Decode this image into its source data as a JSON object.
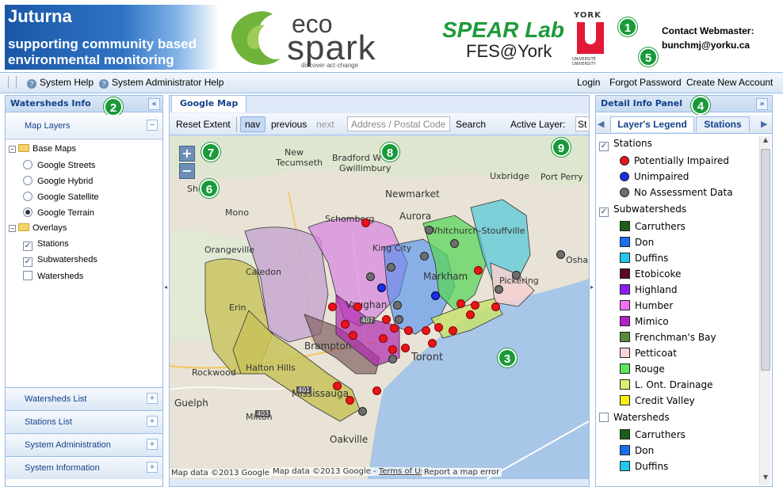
{
  "header": {
    "juturna_title": "Juturna",
    "juturna_line1": "supporting community based",
    "juturna_line2": "environmental monitoring",
    "eco_word": "eco",
    "spark_word": "spark",
    "spark_tagline": "discover·act·change",
    "spear_word": "SPEAR Lab",
    "fes_word": "FES@York",
    "york_word": "YORK",
    "york_univ": "UNIVERSITÉ UNIVERSITY",
    "contact_label": "Contact Webmaster:",
    "contact_email": "bunchmj@yorku.ca"
  },
  "menubar": {
    "system_help": "System Help",
    "admin_help": "System Administrator Help",
    "login": "Login",
    "forgot": "Forgot Password",
    "create": "Create New Account"
  },
  "left_panel": {
    "title": "Watersheds Info",
    "map_layers": "Map Layers",
    "base_maps": "Base Maps",
    "base_items": [
      {
        "label": "Google Streets",
        "selected": false
      },
      {
        "label": "Google Hybrid",
        "selected": false
      },
      {
        "label": "Google Satellite",
        "selected": false
      },
      {
        "label": "Google Terrain",
        "selected": true
      }
    ],
    "overlays": "Overlays",
    "overlay_items": [
      {
        "label": "Stations",
        "checked": true
      },
      {
        "label": "Subwatersheds",
        "checked": true
      },
      {
        "label": "Watersheds",
        "checked": false
      }
    ],
    "sections": [
      "Watersheds List",
      "Stations List",
      "System Administration",
      "System Information"
    ]
  },
  "center": {
    "tab": "Google Map",
    "reset": "Reset Extent",
    "nav": "nav",
    "previous": "previous",
    "next": "next",
    "address_placeholder": "Address / Postal Code",
    "search": "Search",
    "active_layer_label": "Active Layer:",
    "active_layer_value": "St",
    "zoom_in": "+",
    "zoom_out": "−",
    "map_labels": [
      "New",
      "Tecumseth",
      "Bradford W",
      "Gwillimbury",
      "Uxbridge",
      "Port Perry",
      "Shelb",
      "Newmarket",
      "Mono",
      "Schomberg",
      "Aurora",
      "Whitchurch-Stouffville",
      "Orangeville",
      "King City",
      "Caledon",
      "Osha",
      "Markham",
      "Pickering",
      "Erin",
      "Vaughan",
      "Brampton",
      "Toront",
      "Halton Hills",
      "Rockwood",
      "Mississauga",
      "Guelph",
      "Milton",
      "Oakville"
    ],
    "road_labels": [
      "401",
      "403",
      "407"
    ],
    "attribution1": "Map data ©2013 Google",
    "attribution2": "Map data ©2013 Google - ",
    "terms": "Terms of Use",
    "report": "Report a map error"
  },
  "right_panel": {
    "title": "Detail Info Panel",
    "tab_legend": "Layer's Legend",
    "tab_stations": "Stations",
    "stations_label": "Stations",
    "station_types": [
      {
        "label": "Potentially Impaired",
        "color": "#e8141a"
      },
      {
        "label": "Unimpaired",
        "color": "#1a2ee8"
      },
      {
        "label": "No Assessment Data",
        "color": "#6e6e6e"
      }
    ],
    "subwatersheds_label": "Subwatersheds",
    "subwatersheds": [
      {
        "label": "Carruthers",
        "color": "#1a5e1a"
      },
      {
        "label": "Don",
        "color": "#1a6ef0"
      },
      {
        "label": "Duffins",
        "color": "#20c8f0"
      },
      {
        "label": "Etobicoke",
        "color": "#5a0a28"
      },
      {
        "label": "Highland",
        "color": "#8a1ef0"
      },
      {
        "label": "Humber",
        "color": "#f070f0"
      },
      {
        "label": "Mimico",
        "color": "#b41ec8"
      },
      {
        "label": "Frenchman's Bay",
        "color": "#5a8a3a"
      },
      {
        "label": "Petticoat",
        "color": "#f8d4d4"
      },
      {
        "label": "Rouge",
        "color": "#5ae65a"
      },
      {
        "label": "L. Ont. Drainage",
        "color": "#d8f070"
      },
      {
        "label": "Credit Valley",
        "color": "#f8f010"
      }
    ],
    "watersheds_label": "Watersheds",
    "watersheds": [
      {
        "label": "Carruthers",
        "color": "#1a5e1a"
      },
      {
        "label": "Don",
        "color": "#1a6ef0"
      },
      {
        "label": "Duffins",
        "color": "#20c8f0"
      }
    ]
  },
  "badges": [
    "1",
    "2",
    "3",
    "4",
    "5",
    "6",
    "7",
    "8",
    "9"
  ]
}
